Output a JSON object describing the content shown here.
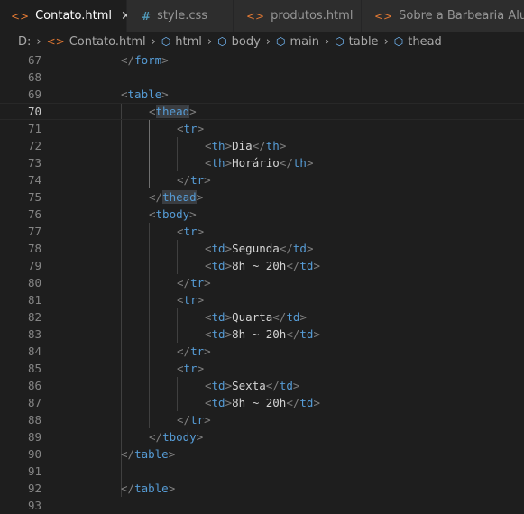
{
  "tabs": [
    {
      "label": "Contato.html",
      "icon": "html-icon",
      "active": true
    },
    {
      "label": "style.css",
      "icon": "css-hash-icon",
      "active": false
    },
    {
      "label": "produtos.html",
      "icon": "html-icon",
      "active": false
    },
    {
      "label": "Sobre a Barbearia Alura.ht",
      "icon": "html-icon",
      "active": false
    }
  ],
  "breadcrumb": [
    "D:",
    "Contato.html",
    "html",
    "body",
    "main",
    "table",
    "thead"
  ],
  "editor": {
    "current_line": 70,
    "lines": [
      {
        "n": "67",
        "code": "</form>"
      },
      {
        "n": "68",
        "code": ""
      },
      {
        "n": "69",
        "code": "<table>"
      },
      {
        "n": "70",
        "code": "<thead>"
      },
      {
        "n": "71",
        "code": "<tr>"
      },
      {
        "n": "72",
        "code": "<th>Dia</th>"
      },
      {
        "n": "73",
        "code": "<th>Horário</th>"
      },
      {
        "n": "74",
        "code": "</tr>"
      },
      {
        "n": "75",
        "code": "</thead>"
      },
      {
        "n": "76",
        "code": "<tbody>"
      },
      {
        "n": "77",
        "code": "<tr>"
      },
      {
        "n": "78",
        "code": "<td>Segunda</td>"
      },
      {
        "n": "79",
        "code": "<td>8h ~ 20h</td>"
      },
      {
        "n": "80",
        "code": "</tr>"
      },
      {
        "n": "81",
        "code": "<tr>"
      },
      {
        "n": "82",
        "code": "<td>Quarta</td>"
      },
      {
        "n": "83",
        "code": "<td>8h ~ 20h</td>"
      },
      {
        "n": "84",
        "code": "</tr>"
      },
      {
        "n": "85",
        "code": "<tr>"
      },
      {
        "n": "86",
        "code": "<td>Sexta</td>"
      },
      {
        "n": "87",
        "code": "<td>8h ~ 20h</td>"
      },
      {
        "n": "88",
        "code": "</tr>"
      },
      {
        "n": "89",
        "code": "</tbody>"
      },
      {
        "n": "90",
        "code": "</table>"
      },
      {
        "n": "91",
        "code": ""
      },
      {
        "n": "92",
        "code": "</table>"
      },
      {
        "n": "93",
        "code": ""
      }
    ]
  },
  "colors": {
    "tag": "#569cd6",
    "bracket": "#808080",
    "text": "#d4d4d4",
    "line_number": "#858585",
    "html_icon": "#e37933",
    "css_icon": "#519aba"
  }
}
